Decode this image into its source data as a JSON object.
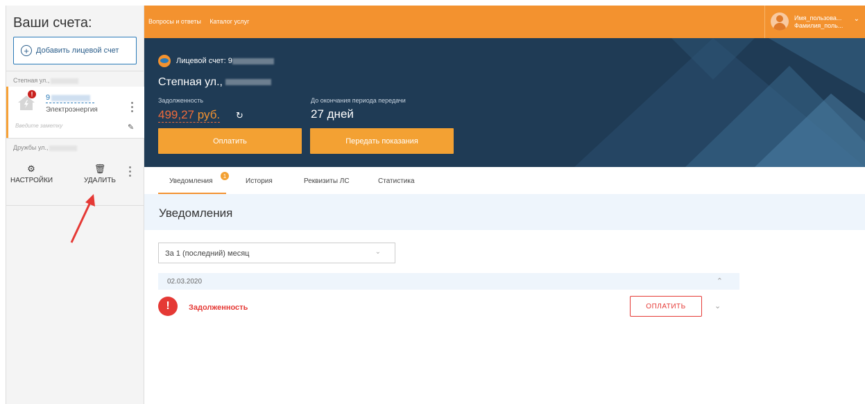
{
  "sidebar": {
    "title": "Ваши счета:",
    "add_account": "Добавить лицевой счет",
    "groups": [
      {
        "address": "Степная ул.,"
      },
      {
        "address": "Дружбы ул.,"
      }
    ],
    "account": {
      "number_prefix": "9",
      "type": "Электроэнергия",
      "note_placeholder": "Введите заметку",
      "alert": "!"
    },
    "actions": {
      "settings": "НАСТРОЙКИ",
      "delete": "УДАЛИТЬ"
    }
  },
  "header": {
    "links": [
      "Вопросы и ответы",
      "Каталог услуг"
    ],
    "user_first": "Имя_пользова...",
    "user_last": "Фамилия_поль..."
  },
  "hero": {
    "account_label": "Лицевой счет: 9",
    "address": "Степная ул.,",
    "debt_label": "Задолженность",
    "debt_value": "499,27",
    "debt_currency": "руб.",
    "period_label": "До окончания периода передачи",
    "days": "27 дней",
    "pay_button": "Оплатить",
    "submit_button": "Передать показания"
  },
  "tabs": {
    "items": [
      "Уведомления",
      "История",
      "Реквизиты ЛС",
      "Статистика"
    ],
    "badge": "1"
  },
  "notifications": {
    "title": "Уведомления",
    "filter": "За 1 (последний) месяц",
    "date": "02.03.2020",
    "item_title": "Задолженность",
    "item_button": "ОПЛАТИТЬ"
  },
  "colors": {
    "accent": "#f3922f",
    "hero_bg": "#1f3b55",
    "error": "#e53935",
    "link": "#2a7ab8"
  }
}
